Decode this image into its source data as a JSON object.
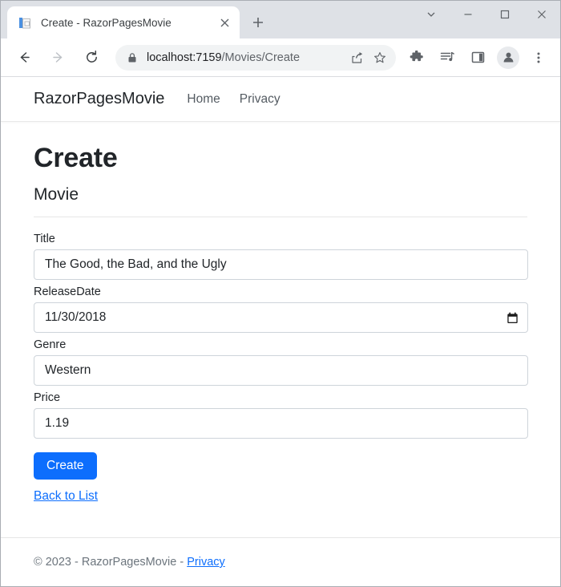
{
  "browser": {
    "tab": {
      "title": "Create - RazorPagesMovie",
      "favicon_name": "razor-page-document-icon",
      "close_label": "×",
      "new_tab_label": "+"
    },
    "window_controls": {
      "tab_search": "tab-search-chevron",
      "minimize": "minimize",
      "maximize": "maximize",
      "close": "close"
    },
    "toolbar": {
      "back": "back-arrow",
      "forward": "forward-arrow",
      "reload": "reload",
      "lock": "site-information-lock",
      "url_host": "localhost:7159",
      "url_path": "/Movies/Create",
      "url_full": "localhost:7159/Movies/Create",
      "share": "share-icon",
      "bookmark": "bookmark-star-icon",
      "extensions": "extensions-puzzle-icon",
      "media": "media-control-icon",
      "side_panel": "side-panel-icon",
      "profile": "profile-avatar",
      "menu": "three-dot-menu"
    }
  },
  "site": {
    "brand": "RazorPagesMovie",
    "nav": [
      {
        "label": "Home"
      },
      {
        "label": "Privacy"
      }
    ]
  },
  "page": {
    "title": "Create",
    "subtitle": "Movie",
    "fields": [
      {
        "label": "Title",
        "value": "The Good, the Bad, and the Ugly",
        "type": "text"
      },
      {
        "label": "ReleaseDate",
        "value": "11/30/2018",
        "type": "date"
      },
      {
        "label": "Genre",
        "value": "Western",
        "type": "text"
      },
      {
        "label": "Price",
        "value": "1.19",
        "type": "text"
      }
    ],
    "submit_label": "Create",
    "back_link": "Back to List"
  },
  "footer": {
    "copyright": "© 2023 - RazorPagesMovie - ",
    "privacy_link": "Privacy"
  },
  "colors": {
    "primary": "#0d6efd",
    "link": "#0d6efd",
    "chrome_titlebar": "#dee1e6",
    "omnibox": "#f1f3f4",
    "border": "#ced4da"
  }
}
